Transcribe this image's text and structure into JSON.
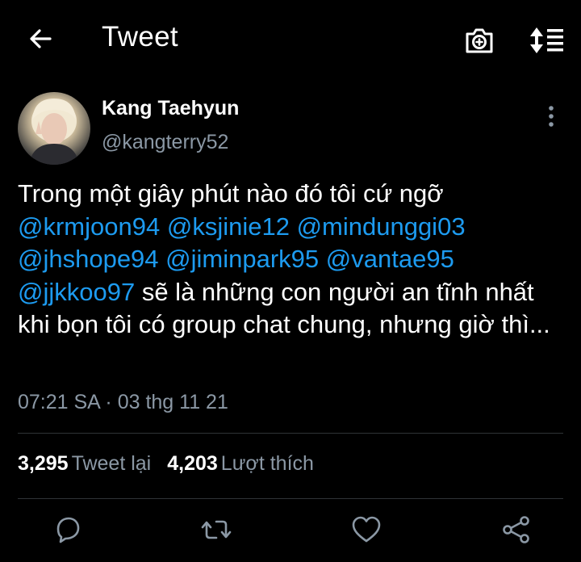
{
  "header": {
    "title": "Tweet",
    "back_icon": "arrow-left-icon",
    "camera_icon": "camera-plus-icon",
    "sort_icon": "sort-list-icon"
  },
  "author": {
    "name": "Kang Taehyun",
    "handle": "@kangterry52"
  },
  "tweet": {
    "text_1": "Trong một giây phút nào đó tôi cứ ngỡ",
    "mentions": [
      "@krmjoon94",
      "@ksjinie12",
      "@mindunggi03",
      "@jhshope94",
      "@jiminpark95",
      "@vantae95",
      "@jjkkoo97"
    ],
    "text_2": " sẽ là những con người an tĩnh nhất khi bọn tôi có group chat chung, nhưng giờ thì...",
    "timestamp": "07:21 SA · 03 thg 11 21"
  },
  "stats": {
    "retweets_count": "3,295",
    "retweets_label": "Tweet lại",
    "likes_count": "4,203",
    "likes_label": "Lượt thích"
  },
  "actions": [
    "reply-icon",
    "retweet-icon",
    "like-icon",
    "share-icon"
  ],
  "colors": {
    "background": "#000000",
    "text": "#ffffff",
    "secondary": "#8b98a5",
    "link": "#1d9bf0",
    "divider": "#2f3336"
  }
}
